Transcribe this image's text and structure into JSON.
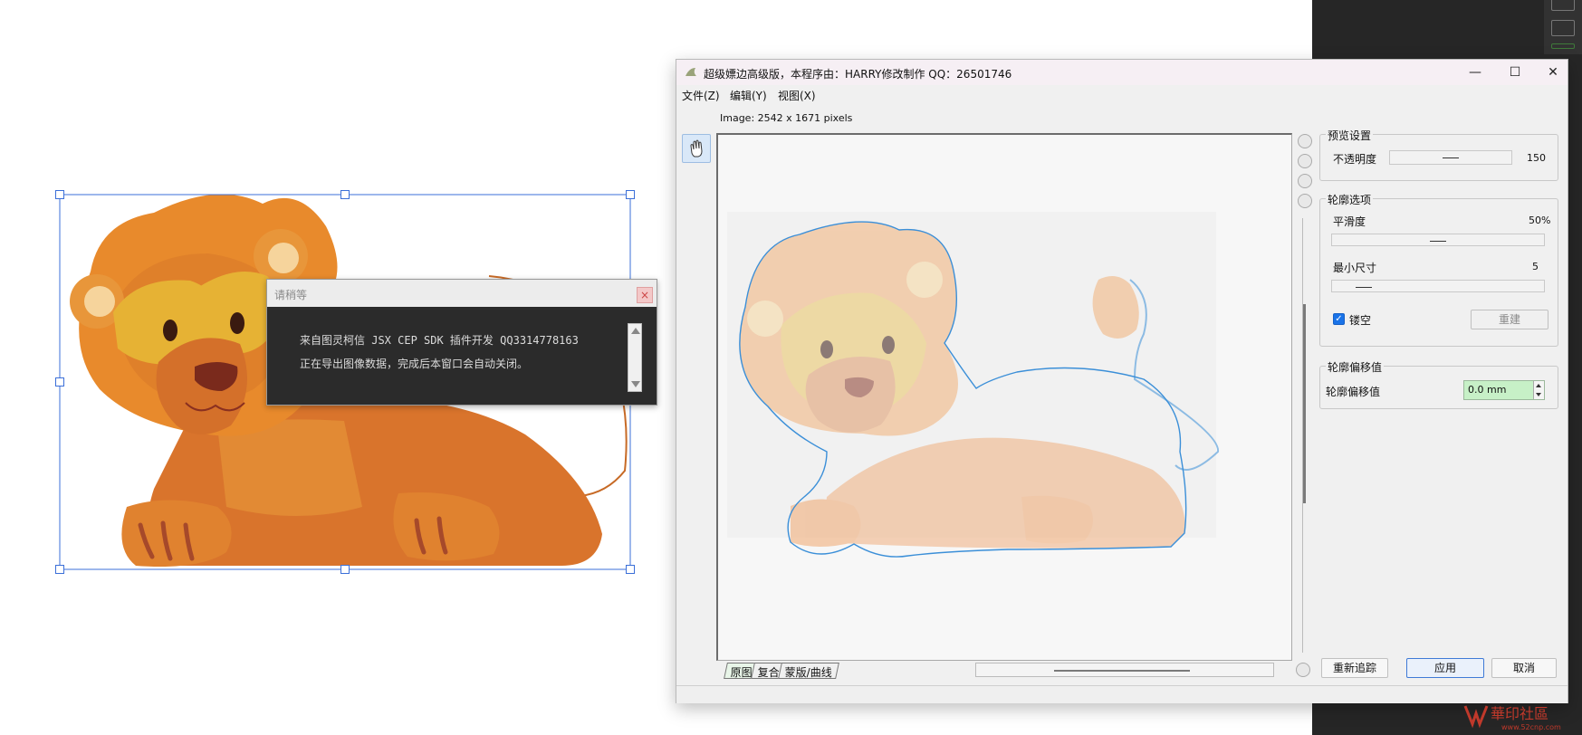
{
  "wait_dialog": {
    "title": "请稍等",
    "close": "×",
    "lines": [
      "来自图灵柯信 JSX CEP SDK 插件开发 QQ3314778163",
      "正在导出图像数据，完成后本窗口会自动关闭。"
    ]
  },
  "window": {
    "title": "超级嫖边高级版，本程序由：HARRY修改制作 QQ：26501746",
    "controls": {
      "minimize": "—",
      "maximize": "☐",
      "close": "✕"
    },
    "menus": [
      "文件(Z)",
      "编辑(Y)",
      "视图(X)"
    ],
    "image_info": "Image: 2542 x 1671 pixels",
    "tabs": [
      "原图",
      "复合",
      "蒙版/曲线"
    ],
    "active_tab": "原图"
  },
  "preview": {
    "group_label": "预览设置",
    "opacity_label": "不透明度",
    "opacity_value": "150",
    "opacity_fraction": 0.5
  },
  "outline": {
    "group_label": "轮廓选项",
    "smooth_label": "平滑度",
    "smooth_value": "50%",
    "smooth_fraction": 0.5,
    "minsize_label": "最小尺寸",
    "minsize_value": "5",
    "minsize_fraction": 0.12,
    "hollow_label": "镂空",
    "hollow_checked": true,
    "rebuild_label": "重建"
  },
  "offset": {
    "group_label": "轮廓偏移值",
    "field_label": "轮廓偏移值",
    "field_value": "0.0 mm"
  },
  "buttons": {
    "retrace": "重新追踪",
    "apply": "应用",
    "cancel": "取消"
  },
  "watermark": {
    "text": "華印社區",
    "url": "www.52cnp.com"
  },
  "colors": {
    "lion_orange": "#e88a2c",
    "lion_dark": "#d4702a",
    "accent_blue": "#3b6fd8"
  }
}
